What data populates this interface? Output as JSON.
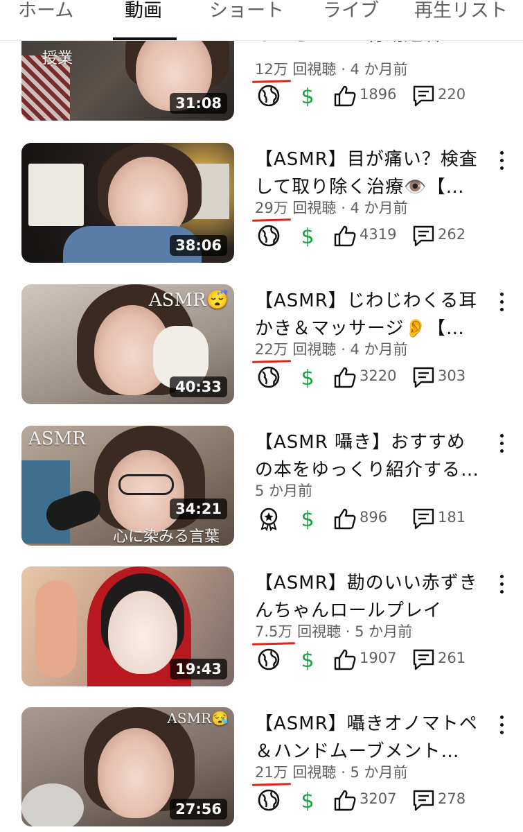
{
  "tabs": [
    {
      "label": "ホーム",
      "active": false
    },
    {
      "label": "動画",
      "active": true
    },
    {
      "label": "ショート",
      "active": false
    },
    {
      "label": "ライブ",
      "active": false
    },
    {
      "label": "再生リスト",
      "active": false
    }
  ],
  "videos": [
    {
      "title": "るべきか？・行動経済",
      "thumb_overlay": "授業",
      "duration": "31:08",
      "views": "12万",
      "views_suffix": "回視聴",
      "age": "4 か月前",
      "visibility_icon": "globe-icon",
      "monetization_icon": "dollar-icon",
      "likes": "1896",
      "comments": "220"
    },
    {
      "title": "【ASMR】目が痛い？検査して取り除く治療👁️【…",
      "thumb_overlay": "",
      "duration": "38:06",
      "views": "29万",
      "views_suffix": "回視聴",
      "age": "4 か月前",
      "visibility_icon": "globe-icon",
      "monetization_icon": "dollar-icon",
      "likes": "4319",
      "comments": "262"
    },
    {
      "title": "【ASMR】じわじわくる耳かき＆マッサージ👂【…",
      "thumb_overlay": "ASMR😴",
      "duration": "40:33",
      "views": "22万",
      "views_suffix": "回視聴",
      "age": "4 か月前",
      "visibility_icon": "globe-icon",
      "monetization_icon": "dollar-icon",
      "likes": "3220",
      "comments": "303"
    },
    {
      "title": "【ASMR 囁き】おすすめの本をゆっくり紹介する…",
      "thumb_overlay": "ASMR",
      "thumb_overlay2": "心に染みる言葉",
      "duration": "34:21",
      "views": "",
      "views_suffix": "",
      "age": "5 か月前",
      "visibility_icon": "premiere-badge-icon",
      "monetization_icon": "dollar-icon",
      "likes": "896",
      "comments": "181"
    },
    {
      "title": "【ASMR】勘のいい赤ずきんちゃんロールプレイ",
      "thumb_overlay": "",
      "duration": "19:43",
      "views": "7.5万",
      "views_suffix": "回視聴",
      "age": "5 か月前",
      "visibility_icon": "globe-icon",
      "monetization_icon": "dollar-icon",
      "likes": "1907",
      "comments": "261"
    },
    {
      "title": "【ASMR】囁きオノマトペ＆ハンドムーブメント…",
      "thumb_overlay": "ASMR😪",
      "duration": "27:56",
      "views": "21万",
      "views_suffix": "回視聴",
      "age": "5 か月前",
      "visibility_icon": "globe-icon",
      "monetization_icon": "dollar-icon",
      "likes": "3207",
      "comments": "278"
    }
  ],
  "colors": {
    "monetization_green": "#1ea446",
    "underline_red": "#e0241b",
    "meta_gray": "#606060"
  }
}
